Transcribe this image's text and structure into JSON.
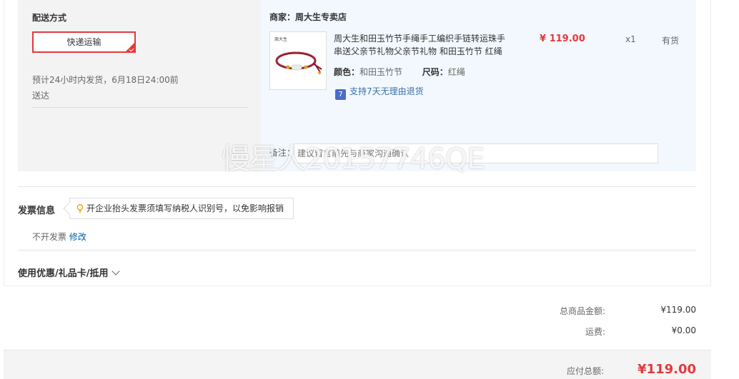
{
  "shipping": {
    "title": "配送方式",
    "method": "快递运输",
    "estimate": "预计24小时内发货，6月18日24:00前送达"
  },
  "order": {
    "merchant_label": "商家：",
    "merchant_name": "周大生专卖店",
    "product": {
      "title": "周大生和田玉竹节手绳手工编织手链转运珠手串送父亲节礼物父亲节礼物 和田玉竹节 红绳",
      "price": "¥ 119.00",
      "quantity": "x1",
      "stock": "有货",
      "color_label": "颜色：",
      "color_value": "和田玉竹节",
      "size_label": "尺码：",
      "size_value": "红绳",
      "return_icon": "7",
      "return_policy": "支持7天无理由退货",
      "image_brand": "周大生"
    },
    "remark_label": "备注：",
    "remark_placeholder": "建议留言前先与商家沟通确认"
  },
  "watermark": "慢星人20157746QE",
  "invoice": {
    "title": "发票信息",
    "tip": "开企业抬头发票须填写纳税人识别号，以免影响报销",
    "status": "不开发票",
    "edit": "修改"
  },
  "coupon": {
    "label": "使用优惠/礼品卡/抵用"
  },
  "summary": {
    "goods_label": "总商品金额:",
    "goods_value": "¥119.00",
    "freight_label": "运费:",
    "freight_value": "¥0.00",
    "total_label": "应付总额:",
    "total_value": "¥119.00"
  },
  "colors": {
    "accent": "#e4393c",
    "link": "#005ea7",
    "panel_bg": "#f3f8fe",
    "block_bg": "#f3f3f3",
    "bar_bg": "#f4f4f4"
  }
}
